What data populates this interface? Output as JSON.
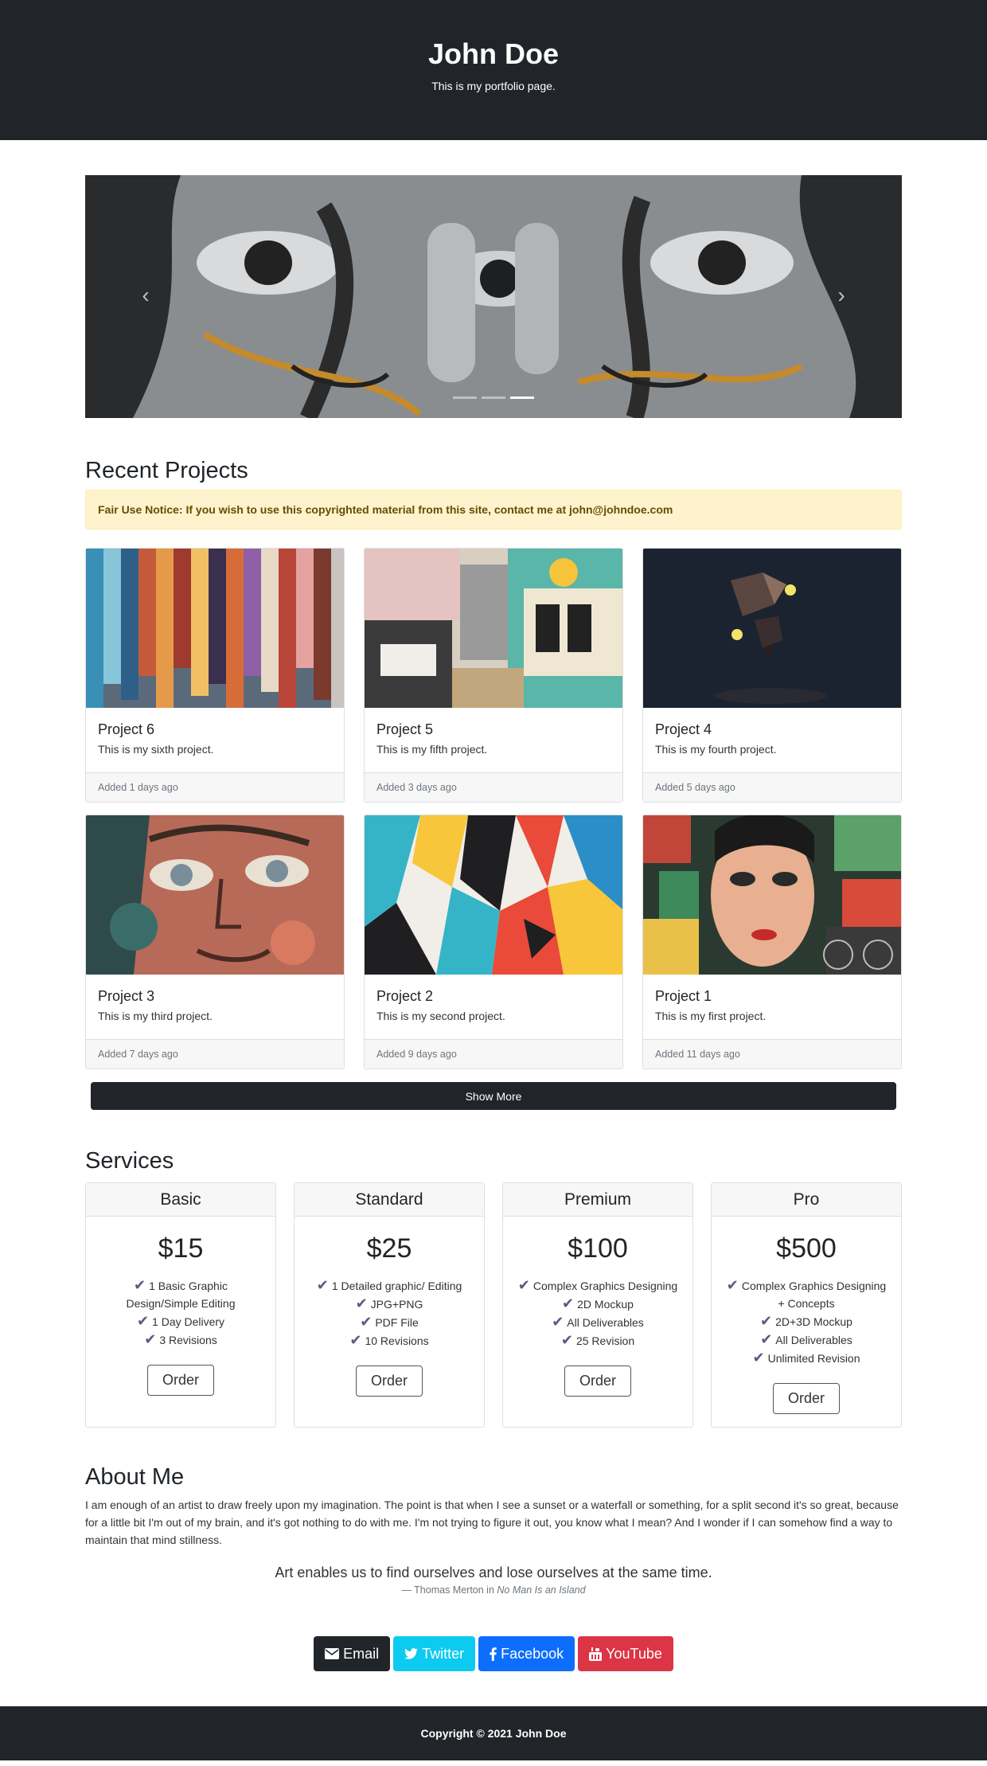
{
  "header": {
    "title": "John Doe",
    "subtitle": "This is my portfolio page."
  },
  "carousel": {
    "prev_icon": "chevron-left-icon",
    "next_icon": "chevron-right-icon",
    "slide_count": 3,
    "active_index": 2
  },
  "projects": {
    "heading": "Recent Projects",
    "notice": "Fair Use Notice: If you wish to use this copyrighted material from this site, contact me at john@johndoe.com",
    "items": [
      {
        "title": "Project 6",
        "text": "This is my sixth project.",
        "added": "Added 1 days ago"
      },
      {
        "title": "Project 5",
        "text": "This is my fifth project.",
        "added": "Added 3 days ago"
      },
      {
        "title": "Project 4",
        "text": "This is my fourth project.",
        "added": "Added 5 days ago"
      },
      {
        "title": "Project 3",
        "text": "This is my third project.",
        "added": "Added 7 days ago"
      },
      {
        "title": "Project 2",
        "text": "This is my second project.",
        "added": "Added 9 days ago"
      },
      {
        "title": "Project 1",
        "text": "This is my first project.",
        "added": "Added 11 days ago"
      }
    ],
    "show_more": "Show More"
  },
  "services": {
    "heading": "Services",
    "order_label": "Order",
    "check_icon": "check-icon",
    "plans": [
      {
        "name": "Basic",
        "price": "$15",
        "features": [
          "1 Basic Graphic Design/Simple Editing",
          "1 Day Delivery",
          "3 Revisions"
        ]
      },
      {
        "name": "Standard",
        "price": "$25",
        "features": [
          "1 Detailed graphic/ Editing",
          "JPG+PNG",
          "PDF File",
          "10 Revisions"
        ]
      },
      {
        "name": "Premium",
        "price": "$100",
        "features": [
          "Complex Graphics Designing",
          "2D Mockup",
          "All Deliverables",
          "25 Revision"
        ]
      },
      {
        "name": "Pro",
        "price": "$500",
        "features": [
          "Complex Graphics Designing + Concepts",
          "2D+3D Mockup",
          "All Deliverables",
          "Unlimited Revision"
        ]
      }
    ]
  },
  "about": {
    "heading": "About Me",
    "text": "I am enough of an artist to draw freely upon my imagination. The point is that when I see a sunset or a waterfall or something, for a split second it's so great, because for a little bit I'm out of my brain, and it's got nothing to do with me. I'm not trying to figure it out, you know what I mean? And I wonder if I can somehow find a way to maintain that mind stillness.",
    "quote": "Art enables us to find ourselves and lose ourselves at the same time.",
    "cite_prefix": "— Thomas Merton in",
    "cite_source": "No Man Is an Island"
  },
  "social": [
    {
      "label": "Email",
      "icon": "envelope-icon",
      "color": "#212529"
    },
    {
      "label": "Twitter",
      "icon": "twitter-icon",
      "color": "#0dcaf0"
    },
    {
      "label": "Facebook",
      "icon": "facebook-icon",
      "color": "#0d6efd"
    },
    {
      "label": "YouTube",
      "icon": "youtube-icon",
      "color": "#dc3545"
    }
  ],
  "footer": {
    "copyright": "Copyright © 2021 John Doe"
  }
}
